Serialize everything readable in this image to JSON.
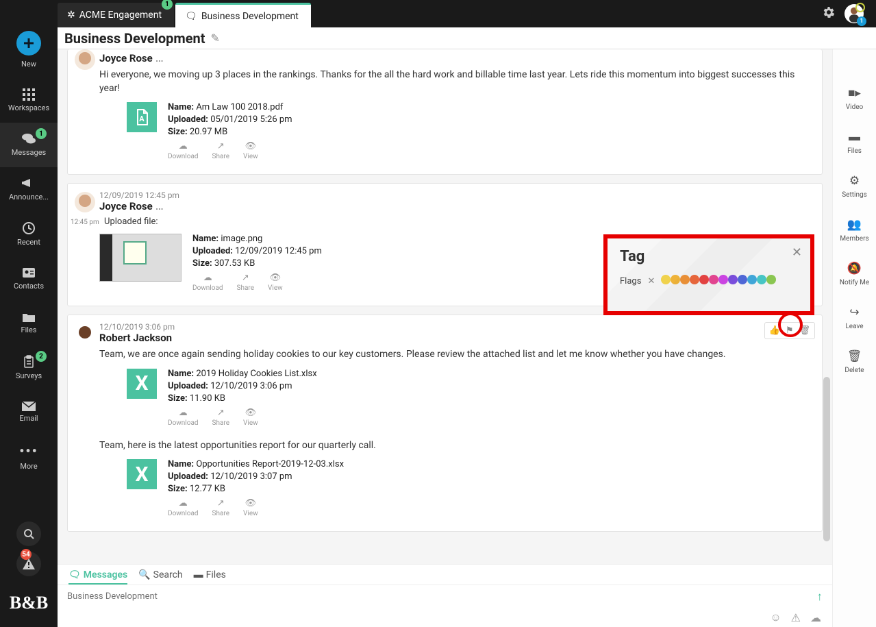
{
  "sidebar": {
    "new_label": "New",
    "items": [
      {
        "label": "Workspaces"
      },
      {
        "label": "Messages",
        "badge": "1"
      },
      {
        "label": "Announce..."
      },
      {
        "label": "Recent"
      },
      {
        "label": "Contacts"
      },
      {
        "label": "Files"
      },
      {
        "label": "Surveys",
        "badge": "2"
      },
      {
        "label": "Email"
      },
      {
        "label": "More"
      }
    ],
    "alerts_badge": "54"
  },
  "tabs": {
    "inactive_label": "ACME Engagement",
    "inactive_badge": "1",
    "active_label": "Business Development"
  },
  "avatar_badge": "1",
  "page_title": "Business Development",
  "rightbar": [
    {
      "label": "Video"
    },
    {
      "label": "Files"
    },
    {
      "label": "Settings"
    },
    {
      "label": "Members"
    },
    {
      "label": "Notify Me"
    },
    {
      "label": "Leave"
    },
    {
      "label": "Delete"
    }
  ],
  "messages": {
    "m1": {
      "author": "Joyce Rose",
      "body": "Hi everyone, we moving up 3 places in the rankings.  Thanks for the all the hard work and billable time last year.  Lets ride this momentum into biggest successes this year!",
      "file": {
        "name": "Am Law 100 2018.pdf",
        "uploaded": "05/01/2019 5:26 pm",
        "size": "20.97 MB"
      }
    },
    "m2": {
      "timestamp": "12/09/2019 12:45 pm",
      "time_short": "12:45 pm",
      "author": "Joyce Rose",
      "uploaded_file_label": "Uploaded file:",
      "file": {
        "name": "image.png",
        "uploaded": "12/09/2019 12:45 pm",
        "size": "307.53 KB"
      }
    },
    "m3": {
      "timestamp": "12/10/2019 3:06 pm",
      "author": "Robert Jackson",
      "body1": "Team, we are once again sending holiday cookies to our key customers. Please review the attached list and let me know whether you have changes.",
      "file1": {
        "name": "2019 Holiday Cookies List.xlsx",
        "uploaded": "12/10/2019 3:06 pm",
        "size": "11.90 KB"
      },
      "body2": "Team, here is the latest opportunities report for our quarterly call.",
      "file2": {
        "name": "Opportunities Report-2019-12-03.xlsx",
        "uploaded": "12/10/2019 3:07 pm",
        "size": "12.77 KB"
      }
    }
  },
  "labels": {
    "name": "Name:",
    "uploaded": "Uploaded:",
    "size": "Size:",
    "download": "Download",
    "share": "Share",
    "view": "View"
  },
  "tag_popup": {
    "title": "Tag",
    "flags_label": "Flags",
    "colors": [
      "#f4d54e",
      "#f3b63a",
      "#f19438",
      "#ee693d",
      "#ea4443",
      "#e94694",
      "#d146e9",
      "#7c4fe0",
      "#5069d9",
      "#41a9db",
      "#48c8c7",
      "#8cc952"
    ]
  },
  "bottom_tabs": {
    "messages": "Messages",
    "search": "Search",
    "files": "Files"
  },
  "composer_placeholder": "Business Development"
}
